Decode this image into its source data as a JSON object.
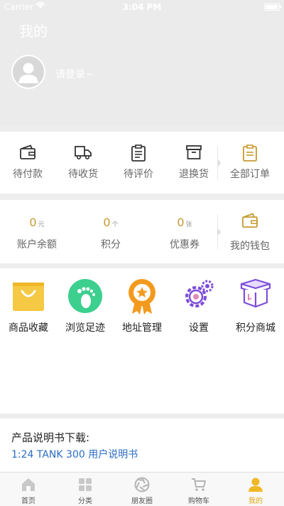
{
  "status_bar": {
    "carrier": "Carrier",
    "time": "3:04 PM"
  },
  "header": {
    "title": "我的",
    "login_prompt": "请登录~"
  },
  "orders": {
    "items": [
      {
        "label": "待付款",
        "icon": "wallet-icon"
      },
      {
        "label": "待收货",
        "icon": "truck-icon"
      },
      {
        "label": "待评价",
        "icon": "clipboard-icon"
      },
      {
        "label": "退换货",
        "icon": "box-icon"
      }
    ],
    "all": {
      "label": "全部订单",
      "icon": "order-list-icon"
    }
  },
  "assets": {
    "items": [
      {
        "value": "0",
        "unit": "元",
        "label": "账户余额"
      },
      {
        "value": "0",
        "unit": "个",
        "label": "积分"
      },
      {
        "value": "0",
        "unit": "张",
        "label": "优惠券"
      }
    ],
    "wallet": {
      "label": "我的钱包",
      "icon": "wallet-icon"
    }
  },
  "services": [
    {
      "label": "商品收藏",
      "icon": "favorites-bag-icon",
      "color": "#f6c944"
    },
    {
      "label": "浏览足迹",
      "icon": "footprint-icon",
      "color": "#3ccf8e"
    },
    {
      "label": "地址管理",
      "icon": "badge-star-icon",
      "color": "#f39a1e"
    },
    {
      "label": "设置",
      "icon": "gear-icon",
      "color": "#7c4ddb"
    },
    {
      "label": "积分商城",
      "icon": "gift-box-icon",
      "color": "#7c4ddb"
    }
  ],
  "manual": {
    "title": "产品说明书下载:",
    "link": "1:24 TANK 300 用户说明书",
    "link_color": "#2b6cc4"
  },
  "tabbar": {
    "active_color": "#e2a611",
    "items": [
      {
        "label": "首页",
        "icon": "home-icon"
      },
      {
        "label": "分类",
        "icon": "grid-icon"
      },
      {
        "label": "朋友圈",
        "icon": "camera-aperture-icon"
      },
      {
        "label": "购物车",
        "icon": "cart-icon"
      },
      {
        "label": "我的",
        "icon": "user-icon",
        "active": true
      }
    ]
  }
}
